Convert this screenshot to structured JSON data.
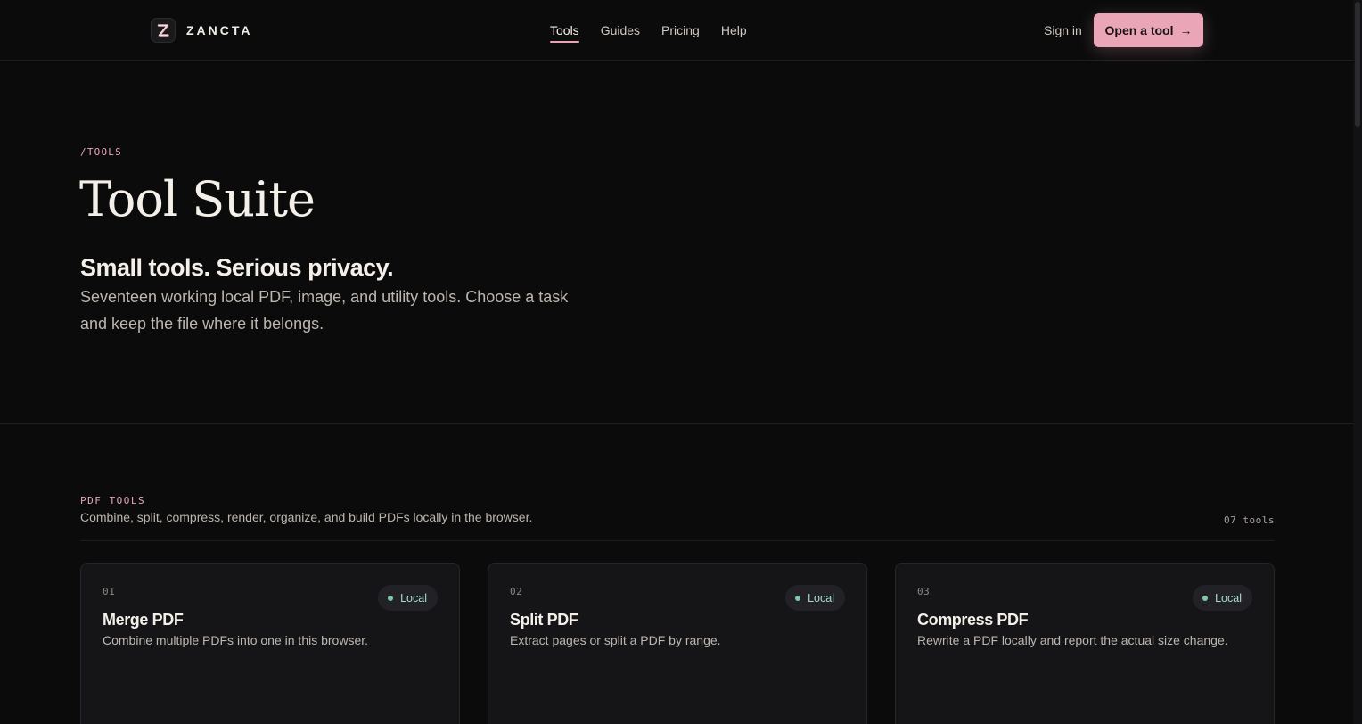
{
  "brand": {
    "name": "ZANCTA",
    "logo_icon": "z-logo-icon"
  },
  "nav": {
    "items": [
      {
        "label": "Tools",
        "active": true
      },
      {
        "label": "Guides",
        "active": false
      },
      {
        "label": "Pricing",
        "active": false
      },
      {
        "label": "Help",
        "active": false
      }
    ],
    "sign_in": "Sign in",
    "cta_label": "Open a tool",
    "cta_arrow": "→"
  },
  "hero": {
    "crumb": "/TOOLS",
    "title": "Tool Suite",
    "tagline": "Small tools. Serious privacy.",
    "lead": "Seventeen working local PDF, image, and utility tools. Choose a task and keep the file where it belongs."
  },
  "section": {
    "label": "PDF TOOLS",
    "description": "Combine, split, compress, render, organize, and build PDFs locally in the browser.",
    "count": "07 tools",
    "cards": [
      {
        "num": "01",
        "title": "Merge PDF",
        "desc": "Combine multiple PDFs into one in this browser.",
        "badge": "Local"
      },
      {
        "num": "02",
        "title": "Split PDF",
        "desc": "Extract pages or split a PDF by range.",
        "badge": "Local"
      },
      {
        "num": "03",
        "title": "Compress PDF",
        "desc": "Rewrite a PDF locally and report the actual size change.",
        "badge": "Local"
      }
    ]
  },
  "colors": {
    "accent": "#eaa6b6",
    "background": "#0b0b0c",
    "badge_text": "#a6dcc6"
  }
}
